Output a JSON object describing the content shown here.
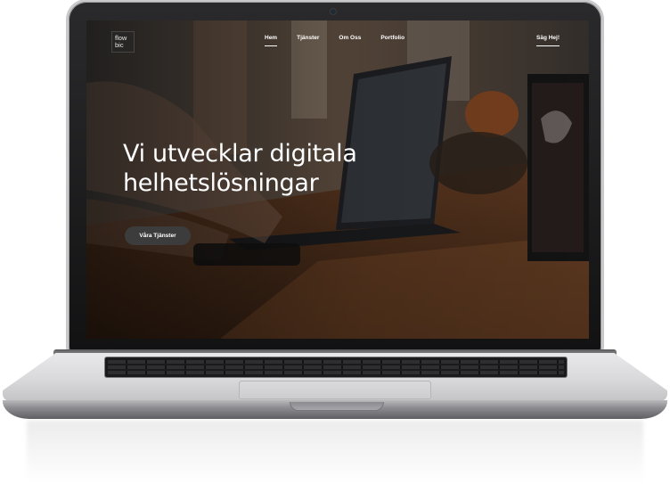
{
  "site": {
    "logo_line1": "flow",
    "logo_line2": "bic",
    "nav": {
      "items": [
        {
          "label": "Hem",
          "active": true
        },
        {
          "label": "Tjänster",
          "active": false
        },
        {
          "label": "Om Oss",
          "active": false
        },
        {
          "label": "Portfolio",
          "active": false
        }
      ],
      "cta_label": "Säg Hej!"
    },
    "hero": {
      "title": "Vi utvecklar digitala helhetslösningar",
      "button_label": "Våra Tjänster"
    }
  },
  "colors": {
    "text": "#ffffff",
    "button_bg": "#3c3c3c",
    "laptop_body": "#d9d9dc",
    "bezel": "#1a1a1c"
  },
  "icons": [
    "camera-icon"
  ]
}
